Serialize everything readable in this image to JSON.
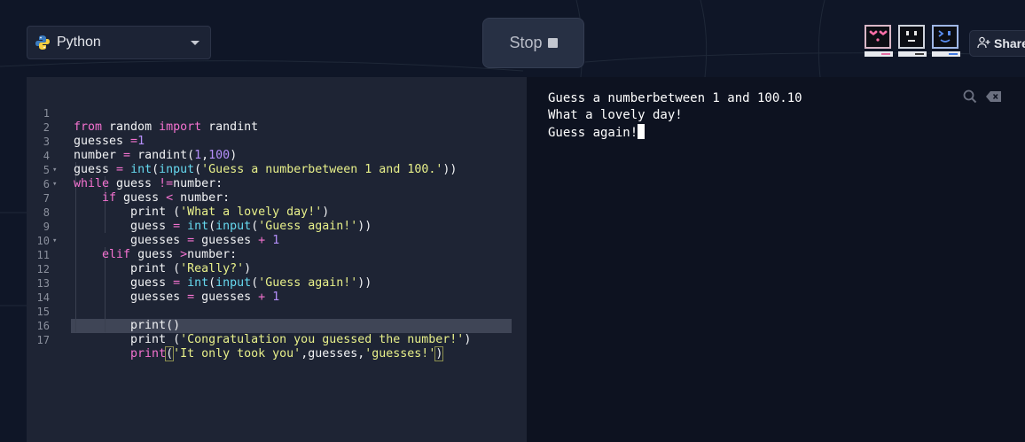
{
  "header": {
    "language": "Python",
    "stop_label": "Stop",
    "share_label": "Share"
  },
  "editor": {
    "lines": [
      {
        "n": "1"
      },
      {
        "n": "2"
      },
      {
        "n": "3"
      },
      {
        "n": "4"
      },
      {
        "n": "5"
      },
      {
        "n": "6"
      },
      {
        "n": "7"
      },
      {
        "n": "8"
      },
      {
        "n": "9"
      },
      {
        "n": "10"
      },
      {
        "n": "11"
      },
      {
        "n": "12"
      },
      {
        "n": "13"
      },
      {
        "n": "14"
      },
      {
        "n": "15"
      },
      {
        "n": "16"
      },
      {
        "n": "17"
      }
    ],
    "code": {
      "l1": [
        "from",
        " random ",
        "import",
        " randint"
      ],
      "l2": [
        "guesses ",
        "=",
        "1"
      ],
      "l3": [
        "number ",
        "=",
        " randint(",
        "1",
        ",",
        "100",
        ")"
      ],
      "l4": [
        "guess ",
        "=",
        " ",
        "int",
        "(",
        "input",
        "(",
        "'Guess a numberbetween 1 and 100.'",
        "))"
      ],
      "l5": [
        "while",
        " guess ",
        "!=",
        "number:"
      ],
      "l6": [
        "    ",
        "if",
        " guess ",
        "<",
        " number:"
      ],
      "l7": [
        "        print (",
        "'What a lovely day!'",
        ")"
      ],
      "l8": [
        "        guess ",
        "=",
        " ",
        "int",
        "(",
        "input",
        "(",
        "'Guess again!'",
        "))"
      ],
      "l9": [
        "        guesses ",
        "=",
        " guesses ",
        "+",
        " ",
        "1"
      ],
      "l10": [
        "    ",
        "elif",
        " guess ",
        ">",
        "number:"
      ],
      "l11": [
        "        print (",
        "'Really?'",
        ")"
      ],
      "l12": [
        "        guess ",
        "=",
        " ",
        "int",
        "(",
        "input",
        "(",
        "'Guess again!'",
        "))"
      ],
      "l13": [
        "        guesses ",
        "=",
        " guesses ",
        "+",
        " ",
        "1"
      ],
      "l15": [
        "        print()"
      ],
      "l16": [
        "        print (",
        "'Congratulation you guessed the number!'",
        ")"
      ],
      "l17": [
        "        print",
        "(",
        "'It only took you'",
        ",guesses,",
        "'guesses!'",
        ")"
      ]
    }
  },
  "console": {
    "output": [
      "Guess a numberbetween 1 and 100.10",
      "What a lovely day!",
      "Guess again!"
    ]
  }
}
